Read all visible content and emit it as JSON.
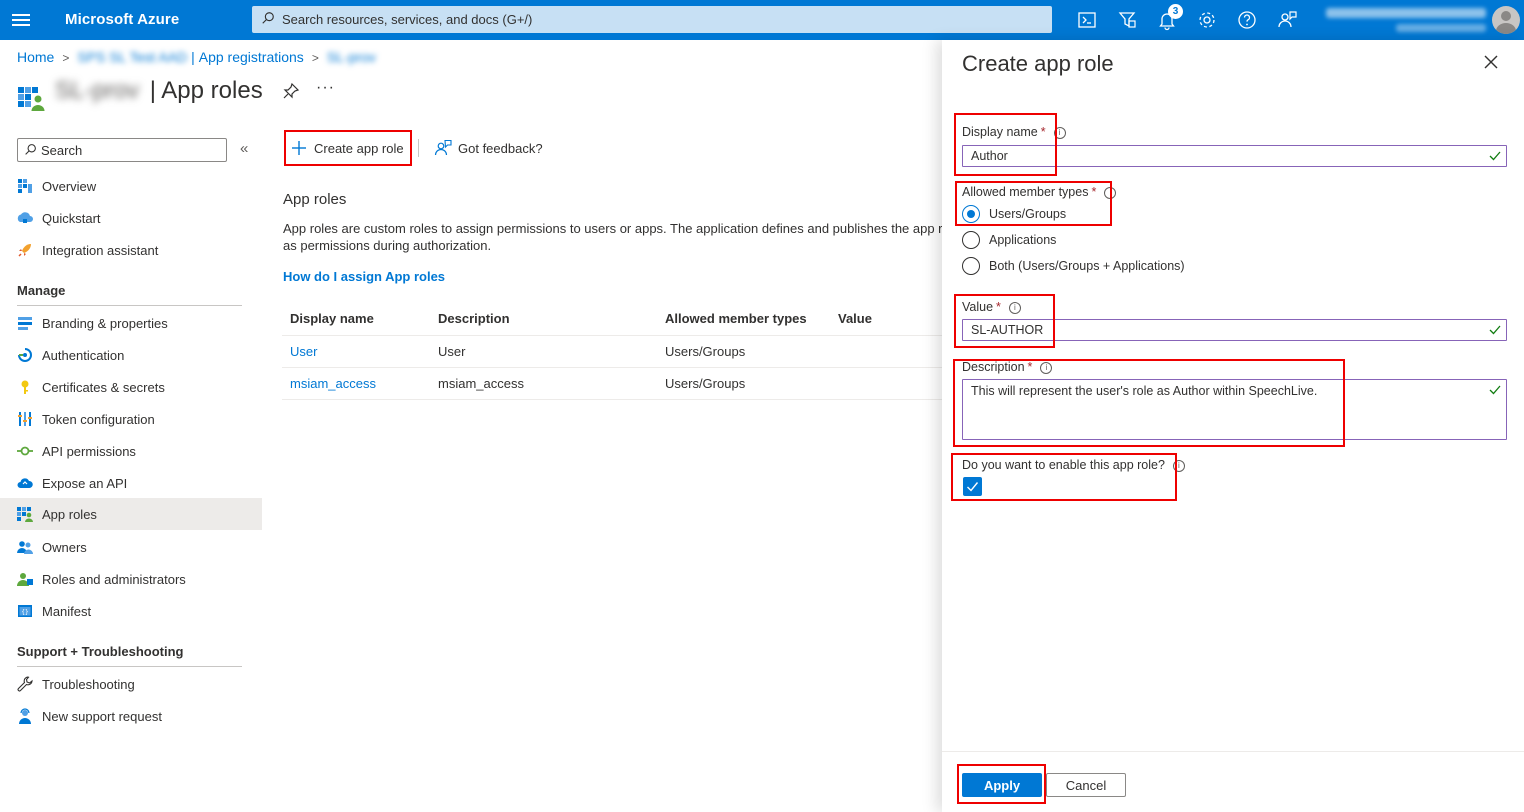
{
  "topbar": {
    "brand": "Microsoft Azure",
    "search_placeholder": "Search resources, services, and docs (G+/)",
    "notification_count": "3",
    "icons": [
      "cloud-shell-icon",
      "directory-filter-icon",
      "bell-icon",
      "gear-icon",
      "help-icon",
      "feedback-icon"
    ]
  },
  "breadcrumb": {
    "home": "Home",
    "tenant": "SPS SL Test AAD",
    "app_registrations": "App registrations",
    "app": "SL-prov"
  },
  "page": {
    "app_name": "SL-prov",
    "title_separator": "|",
    "title": "App roles",
    "more": "···"
  },
  "nav": {
    "search_placeholder": "Search",
    "collapse": "«",
    "top_items": [
      {
        "label": "Overview",
        "icon": "overview-icon"
      },
      {
        "label": "Quickstart",
        "icon": "quickstart-icon"
      },
      {
        "label": "Integration assistant",
        "icon": "rocket-icon"
      }
    ],
    "manage_header": "Manage",
    "manage_items": [
      {
        "label": "Branding & properties",
        "icon": "branding-icon"
      },
      {
        "label": "Authentication",
        "icon": "authentication-icon"
      },
      {
        "label": "Certificates & secrets",
        "icon": "key-icon"
      },
      {
        "label": "Token configuration",
        "icon": "token-icon"
      },
      {
        "label": "API permissions",
        "icon": "api-permissions-icon"
      },
      {
        "label": "Expose an API",
        "icon": "cloud-icon"
      },
      {
        "label": "App roles",
        "icon": "app-roles-icon",
        "active": true
      },
      {
        "label": "Owners",
        "icon": "owners-icon"
      },
      {
        "label": "Roles and administrators",
        "icon": "roles-icon"
      },
      {
        "label": "Manifest",
        "icon": "manifest-icon"
      }
    ],
    "support_header": "Support + Troubleshooting",
    "support_items": [
      {
        "label": "Troubleshooting",
        "icon": "wrench-icon"
      },
      {
        "label": "New support request",
        "icon": "support-person-icon"
      }
    ]
  },
  "commands": {
    "create": "Create app role",
    "feedback": "Got feedback?"
  },
  "main": {
    "section_title": "App roles",
    "description_line1": "App roles are custom roles to assign permissions to users or apps. The application defines and publishes the app ro",
    "description_line2": "as permissions during authorization.",
    "how_link": "How do I assign App roles",
    "table": {
      "columns": [
        "Display name",
        "Description",
        "Allowed member types",
        "Value"
      ],
      "rows": [
        [
          "User",
          "User",
          "Users/Groups",
          ""
        ],
        [
          "msiam_access",
          "msiam_access",
          "Users/Groups",
          ""
        ]
      ]
    }
  },
  "panel": {
    "title": "Create app role",
    "display_name_label": "Display name",
    "display_name_value": "Author",
    "member_types_label": "Allowed member types",
    "member_types": [
      "Users/Groups",
      "Applications",
      "Both (Users/Groups + Applications)"
    ],
    "member_types_selected": "Users/Groups",
    "value_label": "Value",
    "value_value": "SL-AUTHOR",
    "description_label": "Description",
    "description_value": "This will represent the user's role as Author within SpeechLive.",
    "enable_label": "Do you want to enable this app role?",
    "enable_checked": true,
    "required_mark": "*",
    "info_mark": "i",
    "apply": "Apply",
    "cancel": "Cancel"
  },
  "colors": {
    "azure_blue": "#0078d4",
    "highlight_red": "#e00000",
    "valid_green": "#107c10",
    "focus_purple": "#8764b8"
  }
}
